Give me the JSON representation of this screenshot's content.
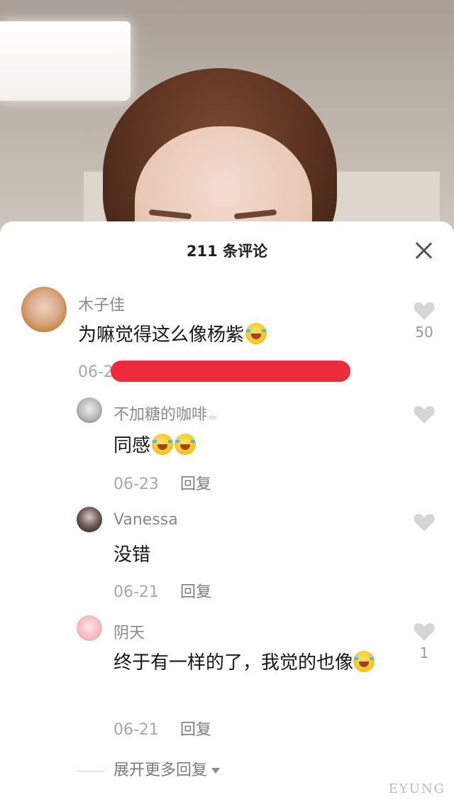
{
  "sheet": {
    "title": "211 条评论"
  },
  "comments": [
    {
      "username": "木子佳",
      "text": "为嘛觉得这么像杨紫",
      "emoji": "rofl-emoji",
      "date_visible": "06-2",
      "likes": "50"
    }
  ],
  "replies": [
    {
      "username": "不加糖的咖啡",
      "username_emoji": "☕",
      "text": "同感",
      "emojis": [
        "laugh-cry-emoji",
        "laugh-cry-emoji"
      ],
      "date": "06-23",
      "reply_label": "回复"
    },
    {
      "username": "Vanessa",
      "text": "没错",
      "date": "06-21",
      "reply_label": "回复"
    },
    {
      "username": "阴天",
      "text": "终于有一样的了，我觉的也像",
      "emoji": "rofl-emoji",
      "date": "06-21",
      "reply_label": "回复",
      "likes": "1"
    }
  ],
  "expand_label": "展开更多回复",
  "watermark": "EYUNG",
  "colors": {
    "redaction": "#ec2b3c",
    "like_icon": "#d5d5d5"
  },
  "icons": {
    "close": "close-icon",
    "like": "heart-icon",
    "expand": "chevron-down-icon"
  }
}
